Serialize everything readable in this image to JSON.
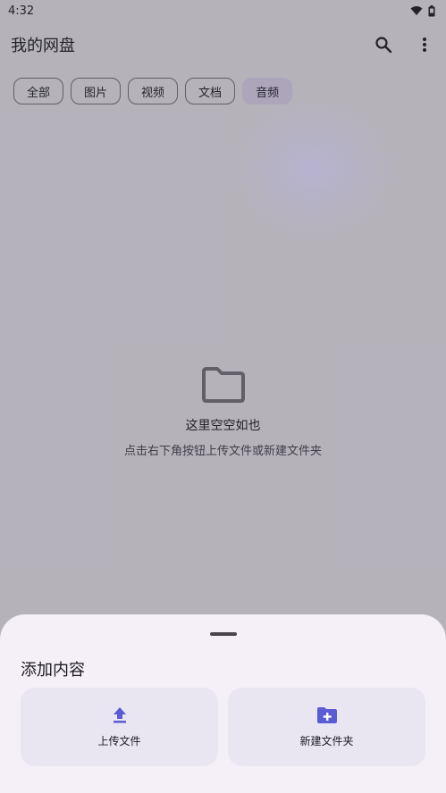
{
  "status_bar": {
    "time": "4:32"
  },
  "app_bar": {
    "title": "我的网盘"
  },
  "filters": [
    {
      "label": "全部",
      "selected": false
    },
    {
      "label": "图片",
      "selected": false
    },
    {
      "label": "视频",
      "selected": false
    },
    {
      "label": "文档",
      "selected": false
    },
    {
      "label": "音频",
      "selected": true
    }
  ],
  "empty_state": {
    "title": "这里空空如也",
    "subtitle": "点击右下角按钮上传文件或新建文件夹"
  },
  "bottom_sheet": {
    "title": "添加内容",
    "actions": [
      {
        "label": "上传文件",
        "icon": "upload-icon"
      },
      {
        "label": "新建文件夹",
        "icon": "new-folder-icon"
      }
    ]
  },
  "colors": {
    "accent": "#5b5bd6",
    "selected_chip": "#e8def8",
    "sheet_bg": "#f5f0f8",
    "card_bg": "#e9e6f1"
  }
}
